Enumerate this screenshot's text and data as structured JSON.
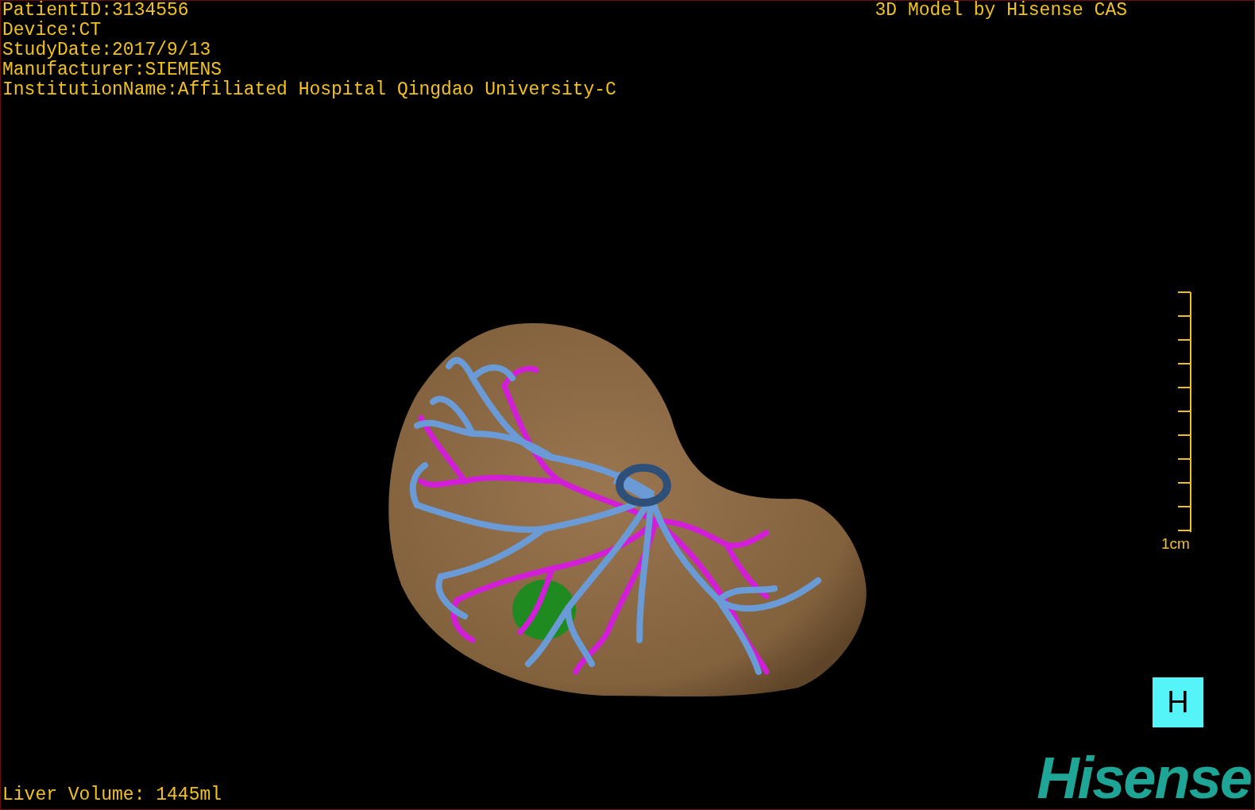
{
  "patient_info": [
    "PatientID:3134556",
    "Device:CT",
    "StudyDate:2017/9/13",
    "Manufacturer:SIEMENS",
    "InstitutionName:Affiliated Hospital Qingdao University-C"
  ],
  "title": "3D Model by Hisense CAS",
  "scale": {
    "label": "1cm"
  },
  "orientation_button": "H",
  "liver_volume": "Liver Volume: 1445ml",
  "logo": "Hisense"
}
